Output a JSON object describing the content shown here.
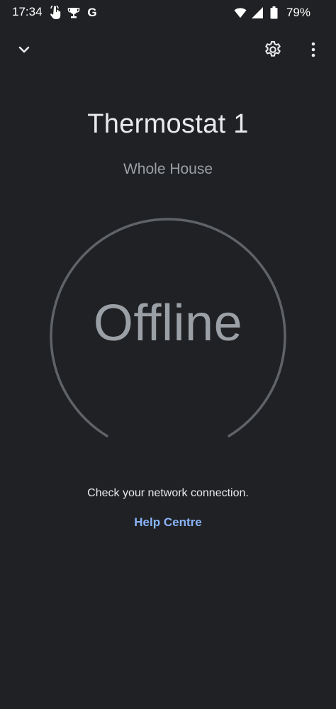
{
  "status_bar": {
    "time": "17:34",
    "left_icons": [
      "touch-gesture-icon",
      "trophy-icon",
      "google-icon"
    ],
    "google_letter": "G",
    "right_icons": [
      "wifi-icon",
      "cellular-signal-icon"
    ],
    "battery": "79%"
  },
  "top_bar": {
    "left_icon": "chevron-down-icon",
    "right_icons": [
      "gear-icon",
      "more-vert-icon"
    ]
  },
  "device": {
    "name": "Thermostat 1",
    "room": "Whole House",
    "state": "Offline"
  },
  "offline_message": "Check your network connection.",
  "help_link": "Help Centre",
  "colors": {
    "background": "#202124",
    "text_primary": "#e8eaed",
    "text_secondary": "#9aa0a6",
    "dial_ring": "#5f6368",
    "link": "#8ab4f8"
  }
}
